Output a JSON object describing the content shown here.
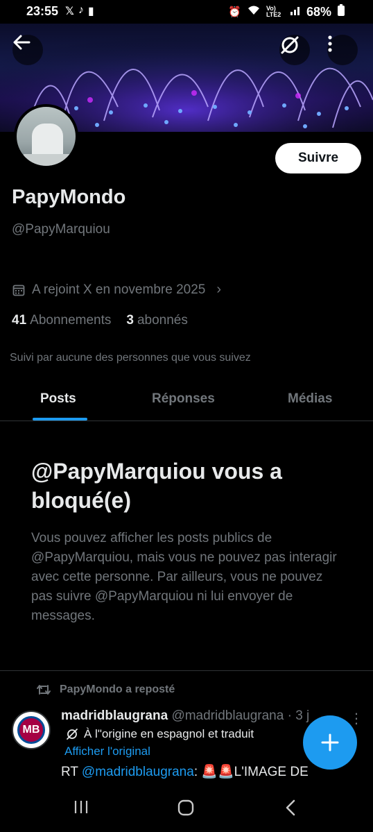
{
  "status_bar": {
    "time": "23:55",
    "battery": "68%",
    "network": "Vo) LTE2"
  },
  "profile": {
    "display_name": "PapyMondo",
    "handle": "@PapyMarquiou",
    "follow_label": "Suivre",
    "joined": "A rejoint X en novembre 2025",
    "following_count": "41",
    "following_label": "Abonnements",
    "followers_count": "3",
    "followers_label": "abonnés",
    "followed_by": "Suivi par aucune des personnes que vous suivez"
  },
  "tabs": [
    {
      "label": "Posts",
      "active": true
    },
    {
      "label": "Réponses",
      "active": false
    },
    {
      "label": "Médias",
      "active": false
    }
  ],
  "blocked": {
    "title": "@PapyMarquiou vous a bloqué(e)",
    "body": "Vous pouvez afficher les posts publics de @PapyMarquiou, mais vous ne pouvez pas interagir avec cette personne. Par ailleurs, vous ne pouvez pas suivre @PapyMarquiou ni lui envoyer de messages."
  },
  "post": {
    "repost_label": "PapyMondo a reposté",
    "author": "madridblaugrana",
    "author_handle": "@madridblaugrana · 3 j",
    "translated_label": "À l\"origine en espagnol et traduit",
    "show_original": "Afficher l'original",
    "text_prefix": "RT ",
    "mention": "@madridblaugrana",
    "text_suffix": ": 🚨🚨L'IMAGE DE"
  },
  "colors": {
    "accent": "#1d9bf0",
    "muted": "#71767b",
    "text": "#e7e9ea",
    "background": "#000000"
  }
}
